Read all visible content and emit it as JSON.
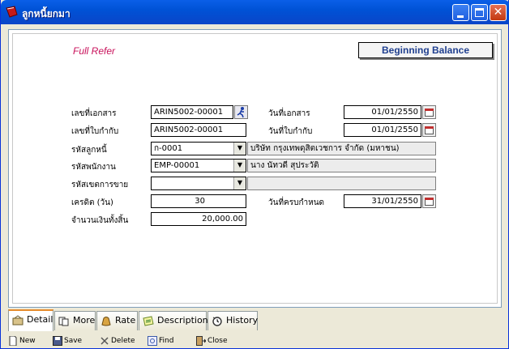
{
  "window": {
    "title": "ลูกหนี้ยกมา"
  },
  "header": {
    "mode": "Full Refer",
    "badge": "Beginning Balance"
  },
  "form": {
    "doc_no_label": "เลขที่เอกสาร",
    "doc_no": "ARIN5002-00001",
    "doc_date_label": "วันที่เอกสาร",
    "doc_date": "01/01/2550",
    "tax_no_label": "เลขที่ใบกำกับ",
    "tax_no": "ARIN5002-00001",
    "tax_date_label": "วันที่ใบกำกับ",
    "tax_date": "01/01/2550",
    "customer_label": "รหัสลูกหนี้",
    "customer_code": "ก-0001",
    "customer_name": "บริษัท กรุงเทพดุสิตเวชการ จำกัด (มหาชน)",
    "employee_label": "รหัสพนักงาน",
    "employee_code": "EMP-00001",
    "employee_name": "นาง นัทวดี สุประวัติ",
    "area_label": "รหัสเขตการขาย",
    "area_code": "",
    "area_name": "",
    "credit_label": "เครดิต (วัน)",
    "credit_days": "30",
    "due_date_label": "วันที่ครบกำหนด",
    "due_date": "31/01/2550",
    "total_label": "จำนวนเงินทั้งสิ้น",
    "total": "20,000.00"
  },
  "tabs": [
    "Detail",
    "More",
    "Rate",
    "Description",
    "History"
  ],
  "toolbar": {
    "new": "New",
    "save": "Save",
    "delete": "Delete",
    "find": "Find",
    "close": "Close"
  },
  "colors": {
    "mode_text": "#c8105a",
    "badge_text": "#1f3f8f",
    "titlebar": "#0052d6"
  }
}
